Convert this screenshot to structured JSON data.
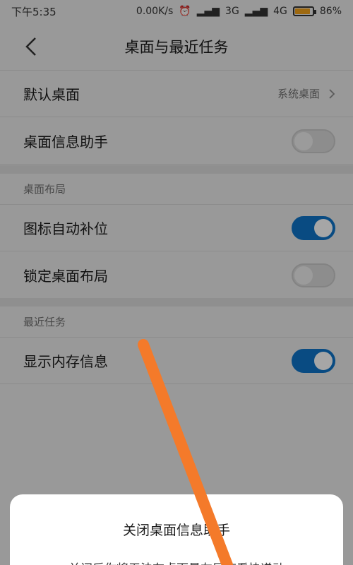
{
  "status_bar": {
    "time": "下午5:35",
    "net_speed": "0.00K/s",
    "signal_3g": "3G",
    "signal_4g": "4G",
    "battery": "86%",
    "battery_level": 0.86,
    "battery_color": "#f3a21a"
  },
  "header": {
    "back_icon": "chevron-left-icon",
    "title": "桌面与最近任务"
  },
  "rows": {
    "default_desktop": {
      "label": "默认桌面",
      "value": "系统桌面"
    },
    "desktop_assistant": {
      "label": "桌面信息助手",
      "toggle": false
    },
    "section_layout": "桌面布局",
    "auto_fill_icons": {
      "label": "图标自动补位",
      "toggle": true
    },
    "lock_layout": {
      "label": "锁定桌面布局",
      "toggle": false
    },
    "section_recent": "最近任务",
    "show_memory": {
      "label": "显示内存信息",
      "toggle": true
    }
  },
  "dialog": {
    "title": "关闭桌面信息助手",
    "message": "关闭后你将无法在桌面最左屏查看快递动"
  },
  "colors": {
    "accent": "#0f74c8",
    "annotation_arrow": "#f47a2a"
  }
}
